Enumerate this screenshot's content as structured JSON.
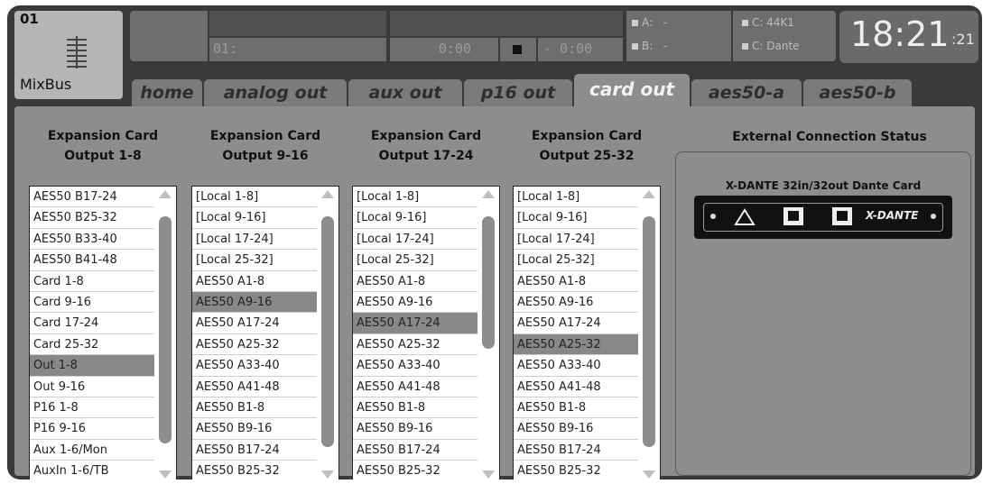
{
  "channel": {
    "number": "01",
    "name": "MixBus"
  },
  "header": {
    "scene_label": "01:",
    "time_elapsed": "0:00",
    "time_remaining": "- 0:00",
    "status": {
      "a": "A:",
      "a_val": "-",
      "b": "B:",
      "b_val": "-",
      "c1": "C:",
      "c1_val": "44K1",
      "c2": "C:",
      "c2_val": "Dante"
    },
    "clock_main": "18:21",
    "clock_seconds": ":21"
  },
  "tabs": [
    "home",
    "analog out",
    "aux out",
    "p16 out",
    "card out",
    "aes50-a",
    "aes50-b"
  ],
  "active_tab": "card out",
  "columns": [
    {
      "title_line1": "Expansion Card",
      "title_line2": "Output 1-8",
      "items": [
        "AES50 B17-24",
        "AES50 B25-32",
        "AES50 B33-40",
        "AES50 B41-48",
        "Card 1-8",
        "Card 9-16",
        "Card 17-24",
        "Card 25-32",
        "Out 1-8",
        "Out 9-16",
        "P16 1-8",
        "P16 9-16",
        "Aux 1-6/Mon",
        "AuxIn 1-6/TB"
      ],
      "selected": 8,
      "thumb": [
        0.1,
        0.87
      ]
    },
    {
      "title_line1": "Expansion Card",
      "title_line2": "Output 9-16",
      "items": [
        "[Local 1-8]",
        "[Local 9-16]",
        "[Local 17-24]",
        "[Local 25-32]",
        "AES50 A1-8",
        "AES50 A9-16",
        "AES50 A17-24",
        "AES50 A25-32",
        "AES50 A33-40",
        "AES50 A41-48",
        "AES50 B1-8",
        "AES50 B9-16",
        "AES50 B17-24",
        "AES50 B25-32"
      ],
      "selected": 5,
      "thumb": [
        0.1,
        0.88
      ]
    },
    {
      "title_line1": "Expansion Card",
      "title_line2": "Output 17-24",
      "items": [
        "[Local 1-8]",
        "[Local 9-16]",
        "[Local 17-24]",
        "[Local 25-32]",
        "AES50 A1-8",
        "AES50 A9-16",
        "AES50 A17-24",
        "AES50 A25-32",
        "AES50 A33-40",
        "AES50 A41-48",
        "AES50 B1-8",
        "AES50 B9-16",
        "AES50 B17-24",
        "AES50 B25-32"
      ],
      "selected": 6,
      "thumb": [
        0.1,
        0.55
      ]
    },
    {
      "title_line1": "Expansion Card",
      "title_line2": "Output 25-32",
      "items": [
        "[Local 1-8]",
        "[Local 9-16]",
        "[Local 17-24]",
        "[Local 25-32]",
        "AES50 A1-8",
        "AES50 A9-16",
        "AES50 A17-24",
        "AES50 A25-32",
        "AES50 A33-40",
        "AES50 A41-48",
        "AES50 B1-8",
        "AES50 B9-16",
        "AES50 B17-24",
        "AES50 B25-32"
      ],
      "selected": 7,
      "thumb": [
        0.1,
        0.88
      ]
    }
  ],
  "external": {
    "title": "External Connection Status",
    "card_name": "X-DANTE  32in/32out Dante Card",
    "card_logo": "X-DANTE"
  }
}
